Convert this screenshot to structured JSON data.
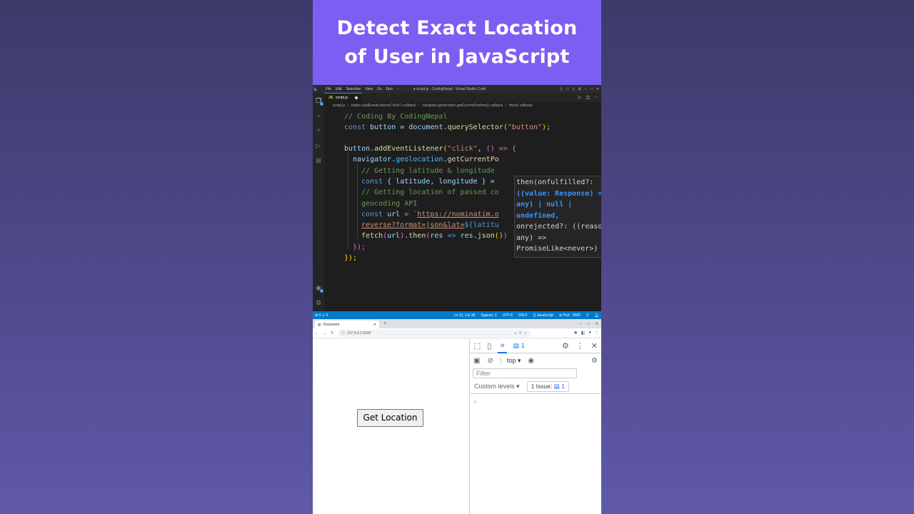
{
  "banner": {
    "line1": "Detect Exact Location",
    "line2": "of User in JavaScript"
  },
  "vscode": {
    "menu": [
      "File",
      "Edit",
      "Selection",
      "View",
      "Go",
      "Run",
      "···"
    ],
    "window_title": "● script.js - CodingNepal - Visual Studio Code",
    "tab": {
      "icon": "JS",
      "label": "script.js"
    },
    "breadcrumbs": [
      "script.js",
      "button.addEventListener(\"click\") callback",
      "navigator.geolocation.getCurrentPosition() callback",
      "then() callback"
    ],
    "code": {
      "l1": "// Coding By CodingNepal",
      "l2_kw": "const",
      "l2_var": "button",
      "l2_eq": "=",
      "l2_obj": "document",
      "l2_fn": "querySelector",
      "l2_str": "\"button\"",
      "l4_obj": "button",
      "l4_fn": "addEventListener",
      "l4_str": "\"click\"",
      "l4_arrow": "() => {",
      "l5_obj": "navigator",
      "l5_prop": "geolocation",
      "l5_fn": "getCurrentPo",
      "l6": "// Getting latitude & longitude",
      "l7_kw": "const",
      "l7_vars": "{ latitude, longitude } =",
      "l8": "// Getting location of passed co",
      "l9": "geocoding API",
      "l10_kw": "const",
      "l10_var": "url",
      "l10_eq": "= `",
      "l10_str": "https://nominatim.o",
      "l11_str": "reverse?format=json&lat=",
      "l11_interp": "${latitu",
      "l12_fn": "fetch",
      "l12_var": "url",
      "l12_fn2": "then",
      "l12_arg": "res",
      "l12_arrow": "=>",
      "l12_obj": "res",
      "l12_fn3": "json",
      "l13": "});",
      "l14": "});"
    },
    "tooltip": [
      "then(onfulfilled?:",
      "((value: Response) =>",
      "any) | null |",
      "undefined,",
      "onrejected?: ((reason:",
      "any) =>",
      "PromiseLike<never>) |"
    ],
    "status": {
      "left": "⊗ 0 ⚠ 0",
      "position": "Ln 10, Col 38",
      "spaces": "Spaces: 2",
      "encoding": "UTF-8",
      "eol": "CRLF",
      "language": "{} JavaScript",
      "port": "⊘ Port : 5500"
    }
  },
  "browser": {
    "tab_title": "Document",
    "url": "127.0.0.1:5500",
    "button_label": "Get Location",
    "devtools": {
      "issues_count": "1",
      "context": "top",
      "filter_placeholder": "Filter",
      "levels": "Custom levels",
      "issue_chip_label": "1 Issue:",
      "issue_chip_count": "1",
      "prompt": "›"
    }
  }
}
